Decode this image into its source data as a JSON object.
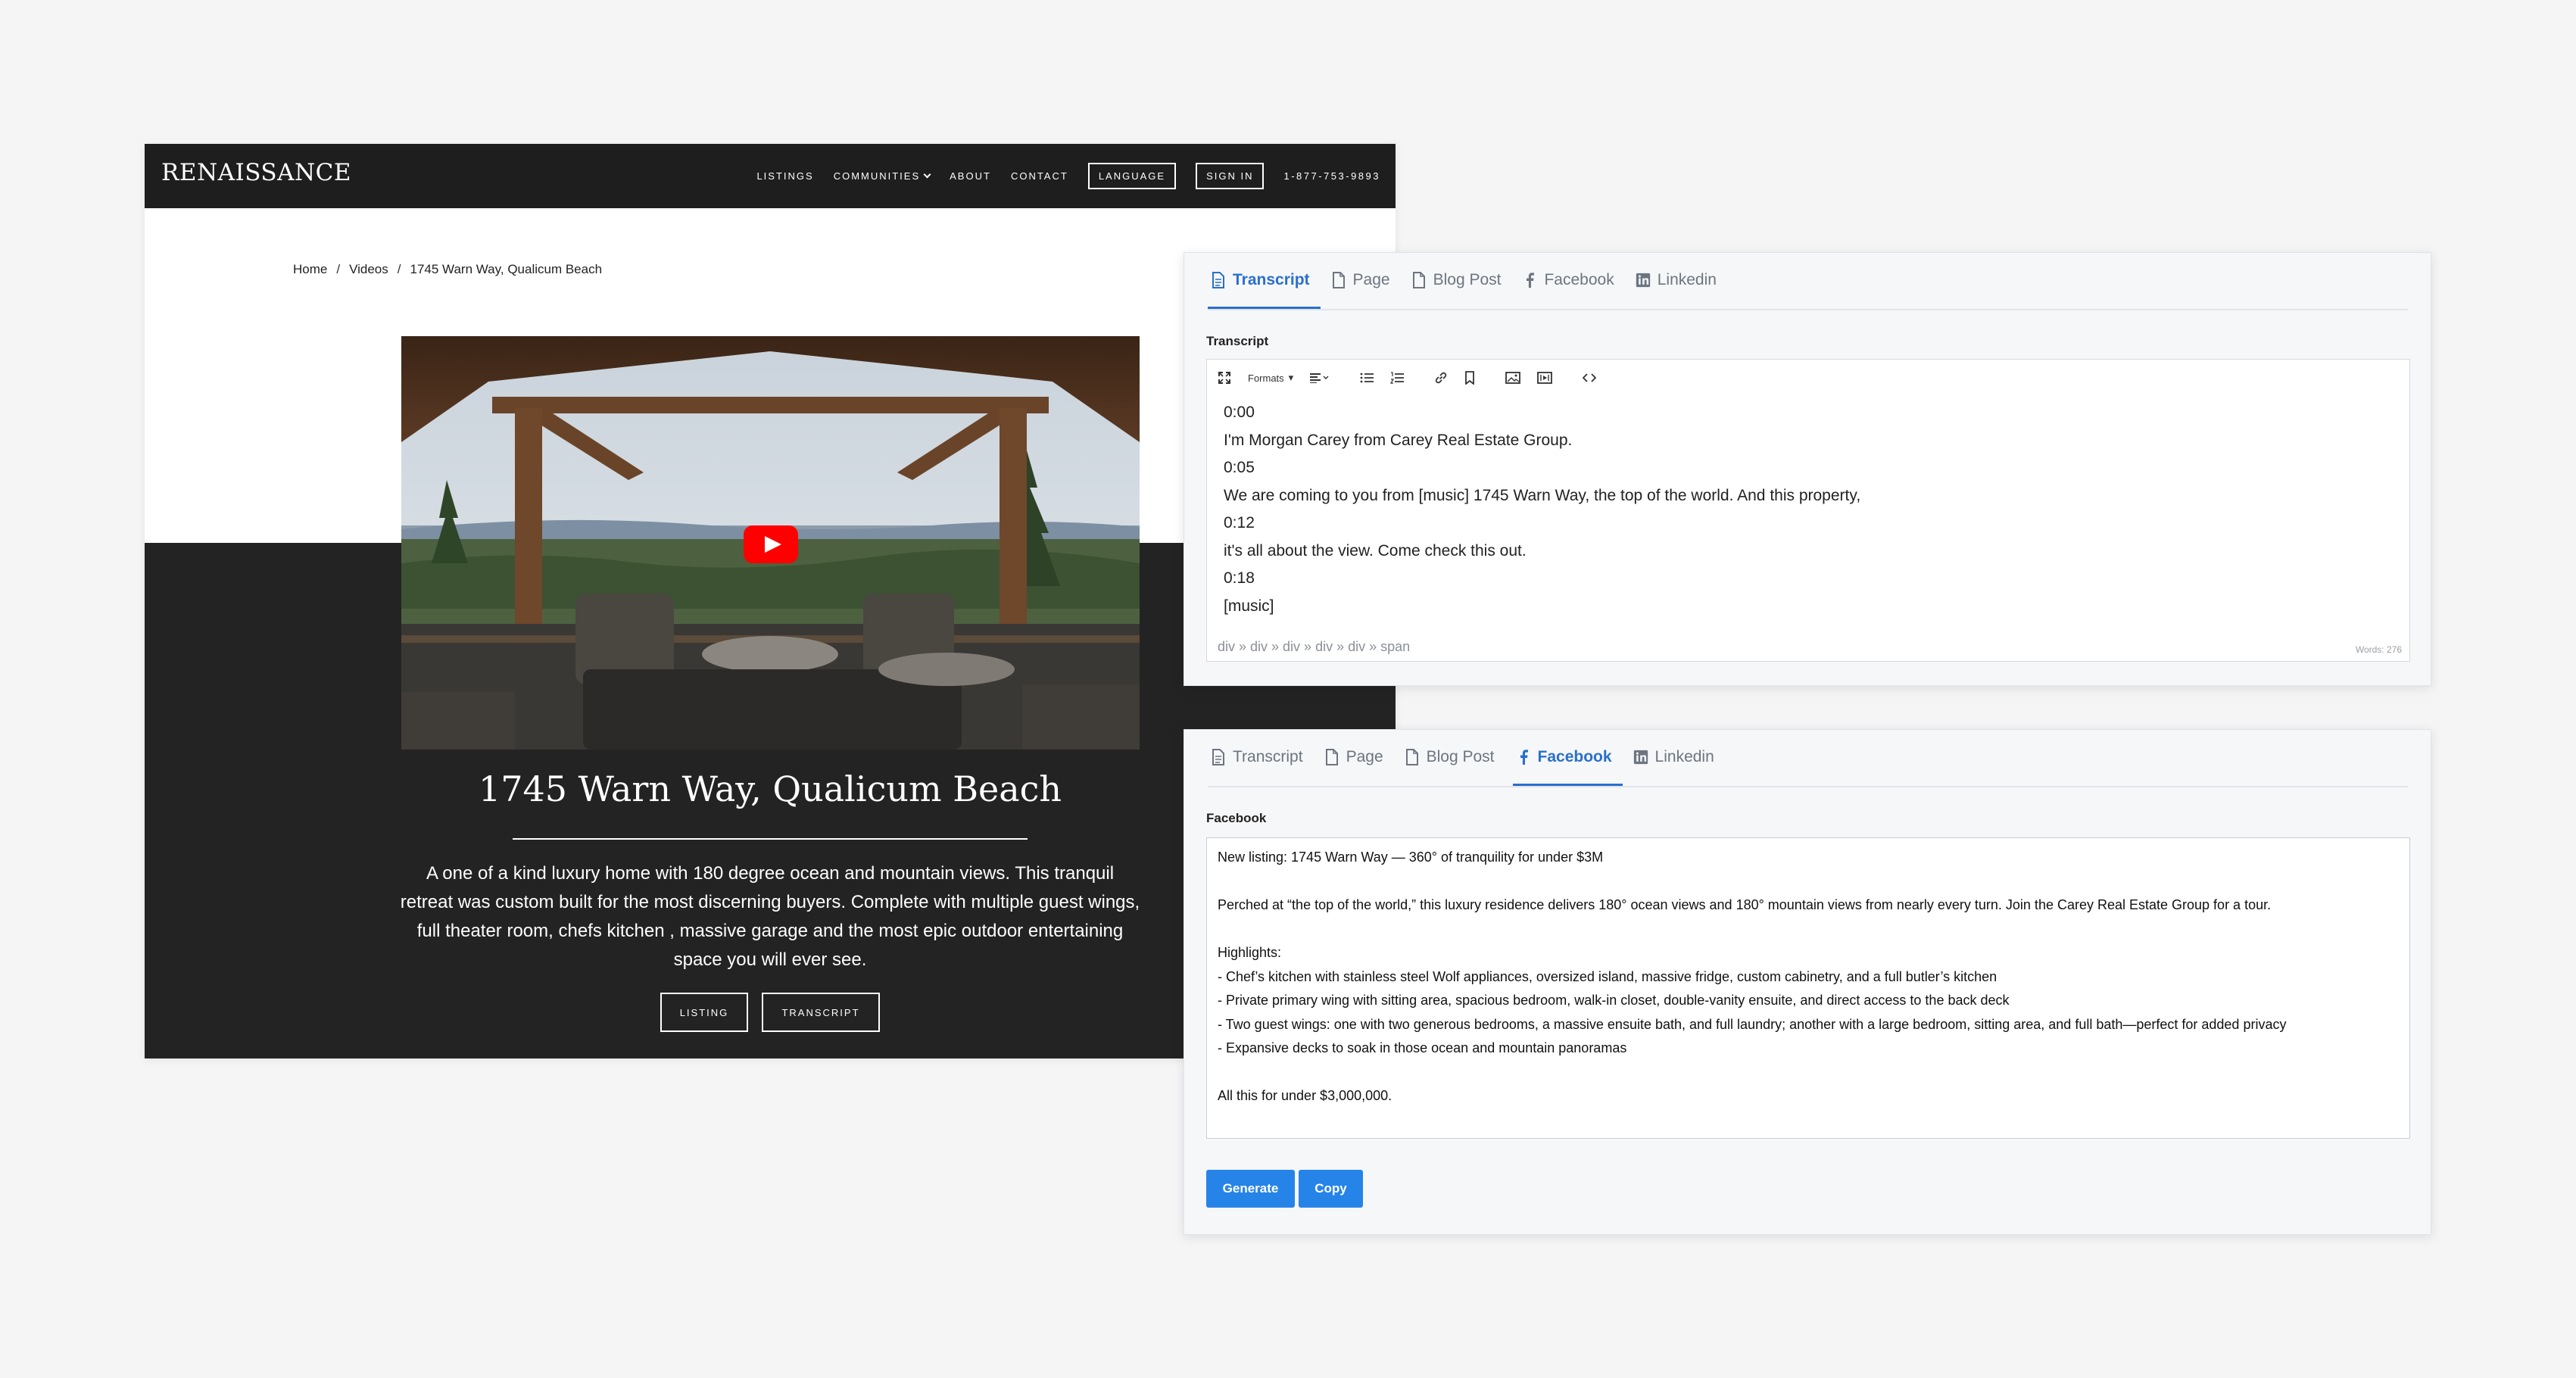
{
  "site": {
    "brand": "RENAISSANCE",
    "nav": {
      "listings": "LISTINGS",
      "communities": "COMMUNITIES",
      "about": "ABOUT",
      "contact": "CONTACT",
      "language": "LANGUAGE",
      "sign_in": "SIGN IN",
      "phone": "1-877-753-9893"
    },
    "breadcrumb": [
      "Home",
      "Videos",
      "1745 Warn Way, Qualicum Beach"
    ],
    "breadcrumb_sep": "/",
    "video_icon": "youtube-play-icon",
    "title": "1745 Warn Way, Qualicum Beach",
    "description": "A one of a kind luxury home with 180 degree ocean and mountain views. This tranquil retreat was custom built for the most discerning buyers. Complete with multiple guest wings, full theater room, chefs kitchen , massive garage and the most epic outdoor entertaining space you will ever see.",
    "buttons": {
      "listing": "LISTING",
      "transcript": "TRANSCRIPT"
    }
  },
  "tabs": {
    "transcript": "Transcript",
    "page": "Page",
    "blog_post": "Blog Post",
    "facebook": "Facebook",
    "linkedin": "Linkedin"
  },
  "transcript_panel": {
    "active_tab": "transcript",
    "label": "Transcript",
    "toolbar": {
      "formats": "Formats"
    },
    "lines": [
      "0:00",
      "I'm Morgan Carey from Carey Real Estate Group.",
      "0:05",
      "We are coming to you from [music] 1745 Warn Way, the top of the world. And this property,",
      "0:12",
      "it's all about the view. Come check this out.",
      "0:18",
      "[music]"
    ],
    "statusbar": "div » div » div » div » div » span",
    "word_count": "Words: 276"
  },
  "facebook_panel": {
    "active_tab": "facebook",
    "label": "Facebook",
    "text": "New listing: 1745 Warn Way — 360° of tranquility for under $3M\n\nPerched at “the top of the world,” this luxury residence delivers 180° ocean views and 180° mountain views from nearly every turn. Join the Carey Real Estate Group for a tour.\n\nHighlights:\n- Chef’s kitchen with stainless steel Wolf appliances, oversized island, massive fridge, custom cabinetry, and a full butler’s kitchen\n- Private primary wing with sitting area, spacious bedroom, walk-in closet, double-vanity ensuite, and direct access to the back deck\n- Two guest wings: one with two generous bedrooms, a massive ensuite bath, and full laundry; another with a large bedroom, sitting area, and full bath—perfect for added privacy\n- Expansive decks to soak in those ocean and mountain panoramas\n\nAll this for under $3,000,000.",
    "buttons": {
      "generate": "Generate",
      "copy": "Copy"
    }
  },
  "colors": {
    "accent": "#2a6fce",
    "button": "#2684e8",
    "site_dark": "#1e1e1e",
    "youtube_red": "#ff0000"
  }
}
